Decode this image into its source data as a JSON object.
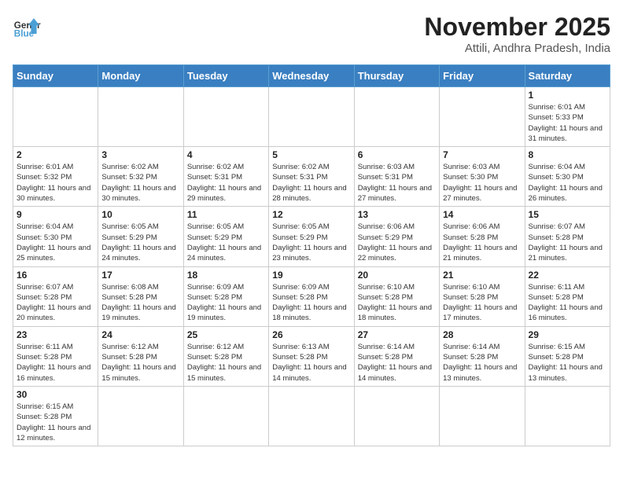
{
  "header": {
    "logo_text_black": "General",
    "logo_text_blue": "Blue",
    "month_year": "November 2025",
    "location": "Attili, Andhra Pradesh, India"
  },
  "weekdays": [
    "Sunday",
    "Monday",
    "Tuesday",
    "Wednesday",
    "Thursday",
    "Friday",
    "Saturday"
  ],
  "weeks": [
    [
      {
        "day": "",
        "info": ""
      },
      {
        "day": "",
        "info": ""
      },
      {
        "day": "",
        "info": ""
      },
      {
        "day": "",
        "info": ""
      },
      {
        "day": "",
        "info": ""
      },
      {
        "day": "",
        "info": ""
      },
      {
        "day": "1",
        "info": "Sunrise: 6:01 AM\nSunset: 5:33 PM\nDaylight: 11 hours\nand 31 minutes."
      }
    ],
    [
      {
        "day": "2",
        "info": "Sunrise: 6:01 AM\nSunset: 5:32 PM\nDaylight: 11 hours\nand 30 minutes."
      },
      {
        "day": "3",
        "info": "Sunrise: 6:02 AM\nSunset: 5:32 PM\nDaylight: 11 hours\nand 30 minutes."
      },
      {
        "day": "4",
        "info": "Sunrise: 6:02 AM\nSunset: 5:31 PM\nDaylight: 11 hours\nand 29 minutes."
      },
      {
        "day": "5",
        "info": "Sunrise: 6:02 AM\nSunset: 5:31 PM\nDaylight: 11 hours\nand 28 minutes."
      },
      {
        "day": "6",
        "info": "Sunrise: 6:03 AM\nSunset: 5:31 PM\nDaylight: 11 hours\nand 27 minutes."
      },
      {
        "day": "7",
        "info": "Sunrise: 6:03 AM\nSunset: 5:30 PM\nDaylight: 11 hours\nand 27 minutes."
      },
      {
        "day": "8",
        "info": "Sunrise: 6:04 AM\nSunset: 5:30 PM\nDaylight: 11 hours\nand 26 minutes."
      }
    ],
    [
      {
        "day": "9",
        "info": "Sunrise: 6:04 AM\nSunset: 5:30 PM\nDaylight: 11 hours\nand 25 minutes."
      },
      {
        "day": "10",
        "info": "Sunrise: 6:05 AM\nSunset: 5:29 PM\nDaylight: 11 hours\nand 24 minutes."
      },
      {
        "day": "11",
        "info": "Sunrise: 6:05 AM\nSunset: 5:29 PM\nDaylight: 11 hours\nand 24 minutes."
      },
      {
        "day": "12",
        "info": "Sunrise: 6:05 AM\nSunset: 5:29 PM\nDaylight: 11 hours\nand 23 minutes."
      },
      {
        "day": "13",
        "info": "Sunrise: 6:06 AM\nSunset: 5:29 PM\nDaylight: 11 hours\nand 22 minutes."
      },
      {
        "day": "14",
        "info": "Sunrise: 6:06 AM\nSunset: 5:28 PM\nDaylight: 11 hours\nand 21 minutes."
      },
      {
        "day": "15",
        "info": "Sunrise: 6:07 AM\nSunset: 5:28 PM\nDaylight: 11 hours\nand 21 minutes."
      }
    ],
    [
      {
        "day": "16",
        "info": "Sunrise: 6:07 AM\nSunset: 5:28 PM\nDaylight: 11 hours\nand 20 minutes."
      },
      {
        "day": "17",
        "info": "Sunrise: 6:08 AM\nSunset: 5:28 PM\nDaylight: 11 hours\nand 19 minutes."
      },
      {
        "day": "18",
        "info": "Sunrise: 6:09 AM\nSunset: 5:28 PM\nDaylight: 11 hours\nand 19 minutes."
      },
      {
        "day": "19",
        "info": "Sunrise: 6:09 AM\nSunset: 5:28 PM\nDaylight: 11 hours\nand 18 minutes."
      },
      {
        "day": "20",
        "info": "Sunrise: 6:10 AM\nSunset: 5:28 PM\nDaylight: 11 hours\nand 18 minutes."
      },
      {
        "day": "21",
        "info": "Sunrise: 6:10 AM\nSunset: 5:28 PM\nDaylight: 11 hours\nand 17 minutes."
      },
      {
        "day": "22",
        "info": "Sunrise: 6:11 AM\nSunset: 5:28 PM\nDaylight: 11 hours\nand 16 minutes."
      }
    ],
    [
      {
        "day": "23",
        "info": "Sunrise: 6:11 AM\nSunset: 5:28 PM\nDaylight: 11 hours\nand 16 minutes."
      },
      {
        "day": "24",
        "info": "Sunrise: 6:12 AM\nSunset: 5:28 PM\nDaylight: 11 hours\nand 15 minutes."
      },
      {
        "day": "25",
        "info": "Sunrise: 6:12 AM\nSunset: 5:28 PM\nDaylight: 11 hours\nand 15 minutes."
      },
      {
        "day": "26",
        "info": "Sunrise: 6:13 AM\nSunset: 5:28 PM\nDaylight: 11 hours\nand 14 minutes."
      },
      {
        "day": "27",
        "info": "Sunrise: 6:14 AM\nSunset: 5:28 PM\nDaylight: 11 hours\nand 14 minutes."
      },
      {
        "day": "28",
        "info": "Sunrise: 6:14 AM\nSunset: 5:28 PM\nDaylight: 11 hours\nand 13 minutes."
      },
      {
        "day": "29",
        "info": "Sunrise: 6:15 AM\nSunset: 5:28 PM\nDaylight: 11 hours\nand 13 minutes."
      }
    ],
    [
      {
        "day": "30",
        "info": "Sunrise: 6:15 AM\nSunset: 5:28 PM\nDaylight: 11 hours\nand 12 minutes."
      },
      {
        "day": "",
        "info": ""
      },
      {
        "day": "",
        "info": ""
      },
      {
        "day": "",
        "info": ""
      },
      {
        "day": "",
        "info": ""
      },
      {
        "day": "",
        "info": ""
      },
      {
        "day": "",
        "info": ""
      }
    ]
  ]
}
